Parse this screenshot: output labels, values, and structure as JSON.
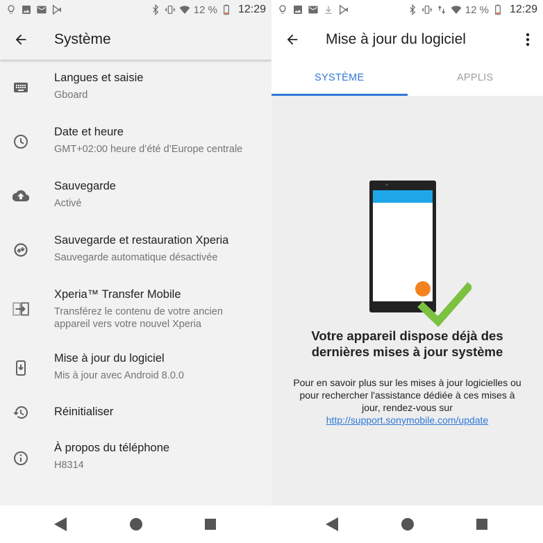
{
  "status": {
    "battery": "12 %",
    "time": "12:29"
  },
  "left": {
    "title": "Système",
    "items": [
      {
        "icon": "keyboard-icon",
        "title": "Langues et saisie",
        "sub": "Gboard"
      },
      {
        "icon": "clock-icon",
        "title": "Date et heure",
        "sub": "GMT+02:00 heure d’été d’Europe centrale"
      },
      {
        "icon": "cloud-upload-icon",
        "title": "Sauvegarde",
        "sub": "Activé"
      },
      {
        "icon": "backup-restore-icon",
        "title": "Sauvegarde et restauration Xperia",
        "sub": "Sauvegarde automatique désactivée"
      },
      {
        "icon": "transfer-icon",
        "title": "Xperia™ Transfer Mobile",
        "sub": "Transférez le contenu de votre ancien",
        "sub2": "appareil vers votre nouvel Xperia"
      },
      {
        "icon": "system-update-icon",
        "title": "Mise à jour du logiciel",
        "sub": "Mis à jour avec Android 8.0.0"
      },
      {
        "icon": "history-icon",
        "title": "Réinitialiser"
      },
      {
        "icon": "info-icon",
        "title": "À propos du téléphone",
        "sub": "H8314"
      }
    ]
  },
  "right": {
    "title": "Mise à jour du logiciel",
    "tabs": [
      "SYSTÈME",
      "APPLIS"
    ],
    "headline1": "Votre appareil dispose déjà des",
    "headline2": "dernières mises à jour système",
    "info1": "Pour en savoir plus sur les mises à jour logicielles ou",
    "info2": "pour rechercher l'assistance dédiée à ces mises à",
    "info3": "jour, rendez-vous sur",
    "link": "http://support.sonymobile.com/update"
  },
  "colors": {
    "accent": "#2f78d6",
    "check": "#7cc241",
    "screen_header": "#1ea7e8",
    "dot": "#f58220"
  }
}
